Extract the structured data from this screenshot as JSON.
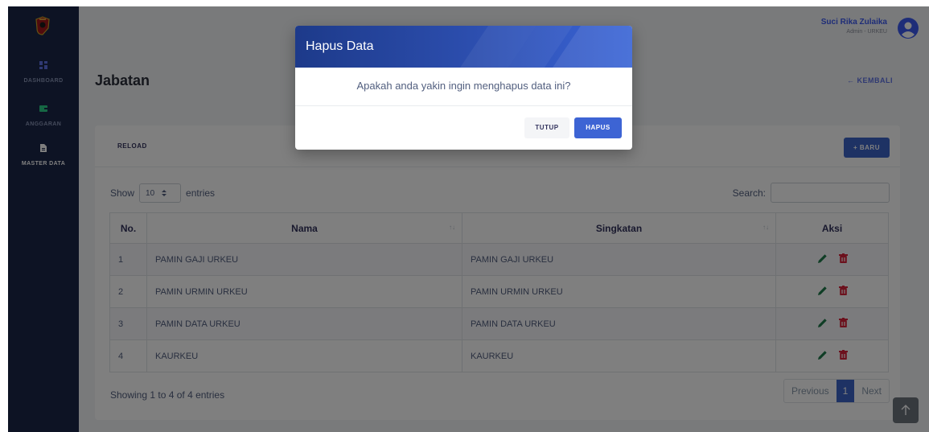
{
  "sidebar": {
    "items": [
      {
        "label": "DASHBOARD",
        "icon": "dashboard-icon"
      },
      {
        "label": "ANGGARAN",
        "icon": "wallet-icon"
      },
      {
        "label": "MASTER DATA",
        "icon": "document-icon"
      }
    ]
  },
  "header": {
    "user_name": "Suci Rika Zulaika",
    "user_role": "Admin - URKEU",
    "page_title": "Jabatan",
    "back_label": "← KEMBALI"
  },
  "card": {
    "reload_label": "RELOAD",
    "new_label": "+ BARU",
    "show_label": "Show",
    "entries_value": "10",
    "entries_label": "entries",
    "search_label": "Search:",
    "columns": [
      "No.",
      "Nama",
      "Singkatan",
      "Aksi"
    ],
    "rows": [
      {
        "no": "1",
        "nama": "PAMIN GAJI URKEU",
        "singkatan": "PAMIN GAJI URKEU"
      },
      {
        "no": "2",
        "nama": "PAMIN URMIN URKEU",
        "singkatan": "PAMIN URMIN URKEU"
      },
      {
        "no": "3",
        "nama": "PAMIN DATA URKEU",
        "singkatan": "PAMIN DATA URKEU"
      },
      {
        "no": "4",
        "nama": "KAURKEU",
        "singkatan": "KAURKEU"
      }
    ],
    "info": "Showing 1 to 4 of 4 entries",
    "pager": {
      "previous": "Previous",
      "current": "1",
      "next": "Next"
    }
  },
  "modal": {
    "title": "Hapus Data",
    "message": "Apakah anda yakin ingin menghapus data ini?",
    "cancel_label": "TUTUP",
    "confirm_label": "HAPUS"
  },
  "colors": {
    "sidebar": "#1a2648",
    "primary": "#3c64c8",
    "edit_icon": "#1e7a4a",
    "delete_icon": "#d8233b"
  }
}
